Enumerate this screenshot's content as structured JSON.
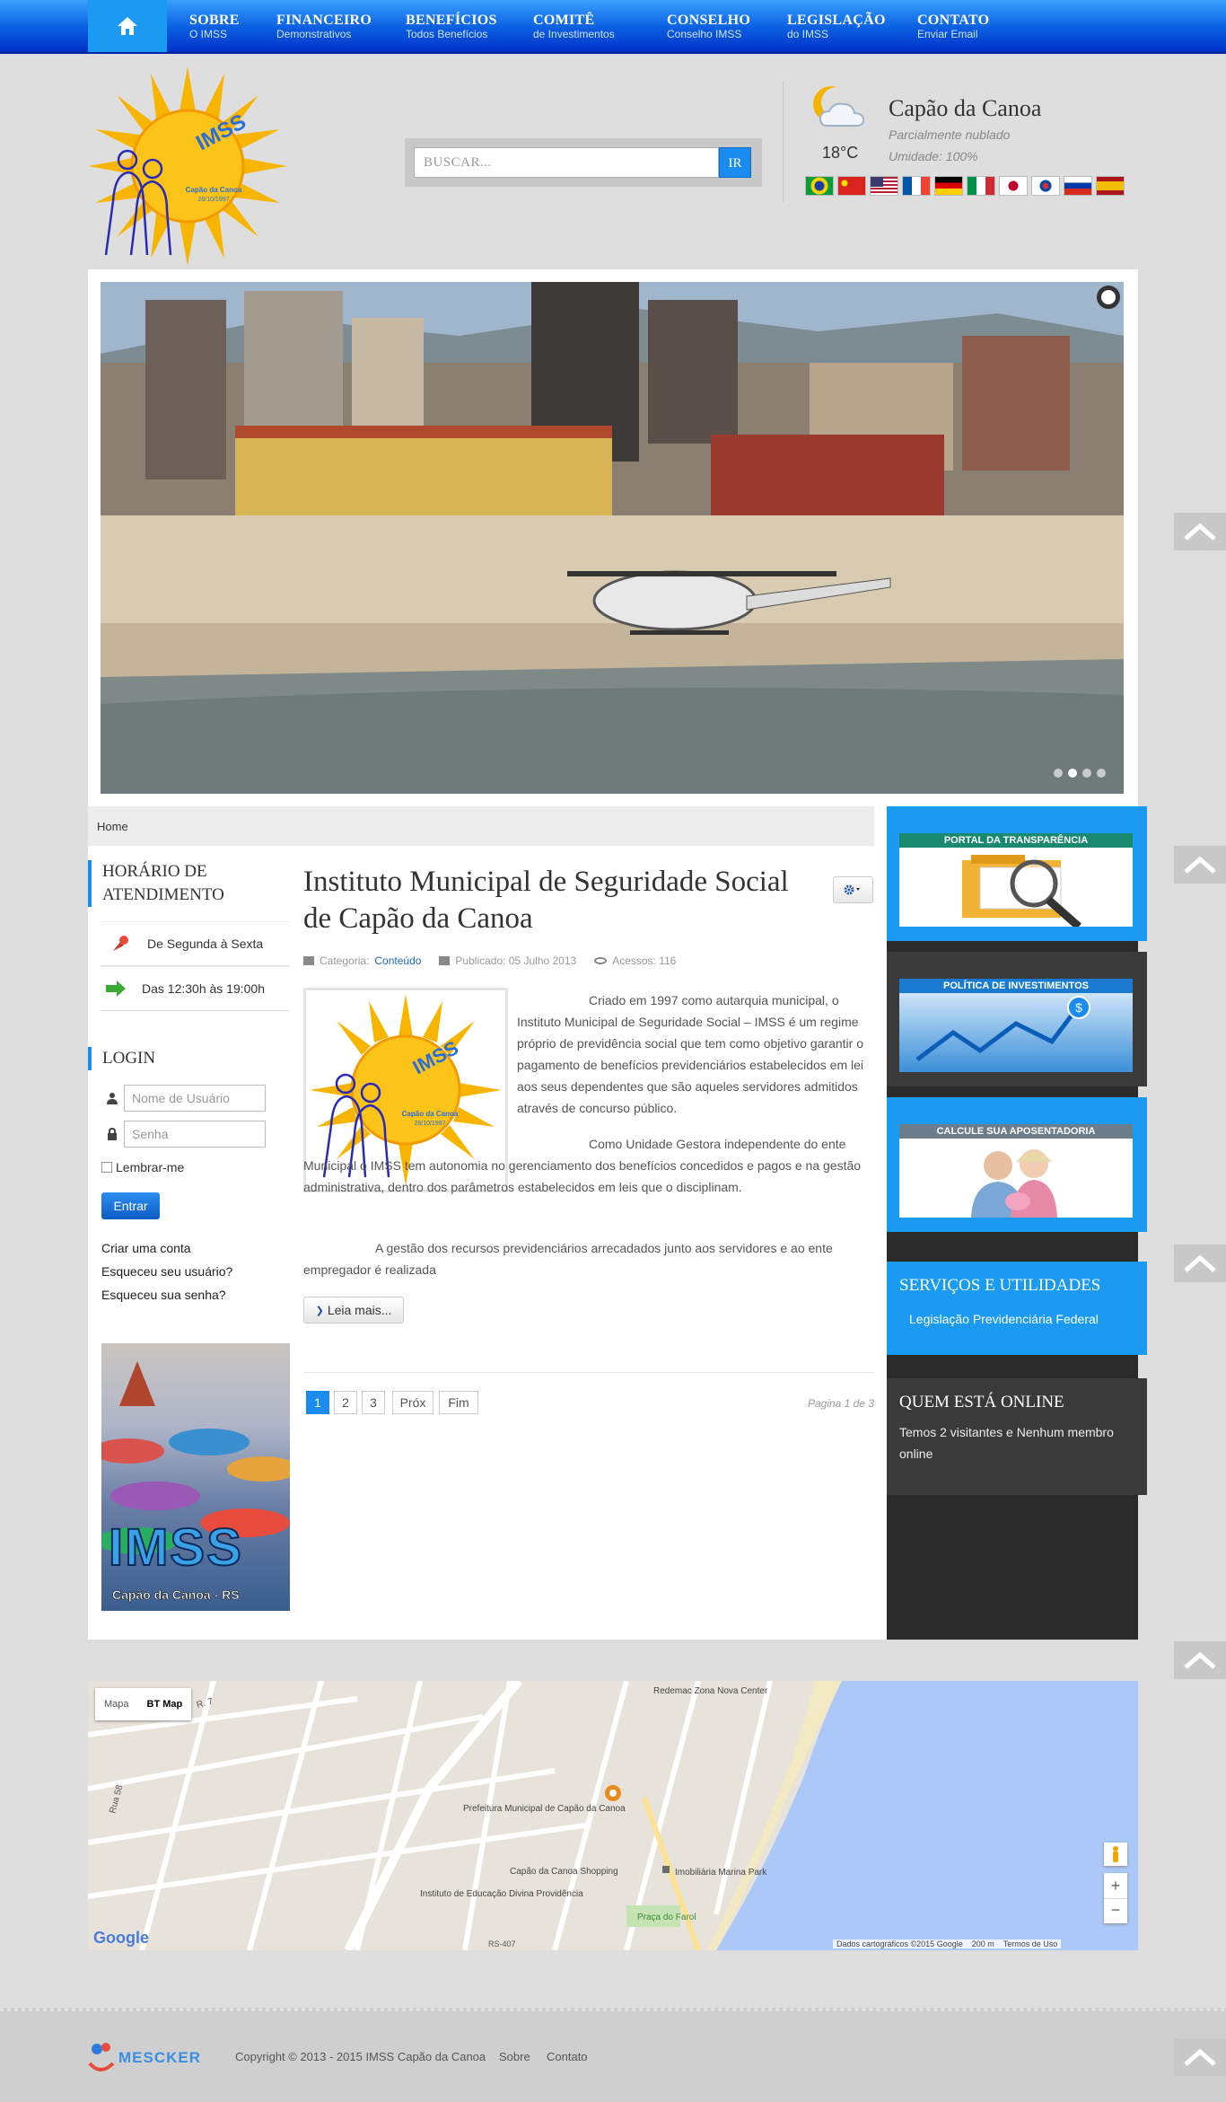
{
  "nav": {
    "items": [
      {
        "title": "SOBRE",
        "sub": "O IMSS"
      },
      {
        "title": "FINANCEIRO",
        "sub": "Demonstrativos"
      },
      {
        "title": "BENEFÍCIOS",
        "sub": "Todos Benefícios"
      },
      {
        "title": "COMITÊ",
        "sub": "de Investimentos"
      },
      {
        "title": "CONSELHO",
        "sub": "Conselho IMSS"
      },
      {
        "title": "LEGISLAÇÃO",
        "sub": "do IMSS"
      },
      {
        "title": "CONTATO",
        "sub": "Enviar Email"
      }
    ]
  },
  "logo": {
    "text": "IMSS",
    "caption": "Capão da Canoa",
    "date": "28/10/1997"
  },
  "search": {
    "placeholder": "BUSCAR...",
    "button": "IR"
  },
  "weather": {
    "city": "Capão da Canoa",
    "condition": "Parcialmente nublado",
    "humidity": "Umidade: 100%",
    "temp": "18°C"
  },
  "flags": [
    "pt-BR",
    "zh",
    "en",
    "fr",
    "de",
    "it",
    "ja",
    "ko",
    "ru",
    "es"
  ],
  "breadcrumb": "Home",
  "hours": {
    "title": "HORÁRIO DE ATENDIMENTO",
    "days": "De Segunda à Sexta",
    "time": "Das 12:30h às 19:00h"
  },
  "login": {
    "title": "LOGIN",
    "username_placeholder": "Nome de Usuário",
    "password_placeholder": "Senha",
    "remember": "Lembrar-me",
    "submit": "Entrar",
    "create": "Criar uma conta",
    "forgot_user": "Esqueceu seu usuário?",
    "forgot_pass": "Esqueceu sua senha?"
  },
  "sidebanner": {
    "title": "IMSS",
    "caption": "Capão da Canoa - RS"
  },
  "article": {
    "title": "Instituto Municipal de Seguridade Social de Capão da Canoa",
    "category_label": "Categoria:",
    "category": "Conteúdo",
    "published": "Publicado: 05 Julho 2013",
    "hits": "Acessos: 116",
    "p1": "Criado em 1997 como autarquia municipal, o Instituto Municipal de Seguridade Social – IMSS é um regime próprio de previdência social que tem como objetivo garantir o pagamento de benefícios previdenciários estabelecidos em lei aos seus dependentes que são aqueles servidores admitidos através de concurso público.",
    "p2": "Como Unidade Gestora independente do ente Municipal o IMSS tem autonomia no gerenciamento dos benefícios concedidos e pagos e na gestão administrativa, dentro dos parâmetros estabelecidos em leis que o disciplinam.",
    "p3": "A gestão dos recursos previdenciários arrecadados junto aos servidores e ao ente empregador é realizada",
    "readmore": "Leia mais..."
  },
  "pagination": {
    "pages": [
      "1",
      "2",
      "3"
    ],
    "next": "Próx",
    "last": "Fim",
    "info": "Pagina 1 de 3"
  },
  "right": {
    "b1": "PORTAL DA TRANSPARÊNCIA",
    "b2": "POLÍTICA DE INVESTIMENTOS",
    "b3": "CALCULE SUA APOSENTADORIA",
    "services_title": "SERVIÇOS E UTILIDADES",
    "services_link": "Legislação Previdenciária Federal",
    "online_title": "QUEM ESTÁ ONLINE",
    "online_text": "Temos 2 visitantes e Nenhum membro online"
  },
  "map": {
    "tab1": "Mapa",
    "tab2": "BT Map",
    "labels": {
      "prefeitura": "Prefeitura Municipal de Capão da Canoa",
      "shopping": "Capão da Canoa Shopping",
      "instituto": "Instituto de Educação Divina Providência",
      "imob": "Imobiliária Marina Park",
      "praca": "Praça do Farol",
      "nova": "Redemac Zona Nova Center",
      "r7": "R. 7",
      "r58": "Rua 58",
      "r407": "RS-407"
    },
    "attribution": "Dados cartográficos ©2015 Google",
    "scale": "200 m",
    "terms": "Termos de Uso",
    "google": "Google"
  },
  "footer": {
    "brand": "MESCKER",
    "copyright": "Copyright © 2013 - 2015 IMSS Capão da Canoa",
    "sobre": "Sobre",
    "contato": "Contato"
  },
  "colors": {
    "accent": "#1a8cf0",
    "navbar": "#0a5ee0",
    "dark": "#2b2b2b",
    "bg": "#dedede"
  }
}
